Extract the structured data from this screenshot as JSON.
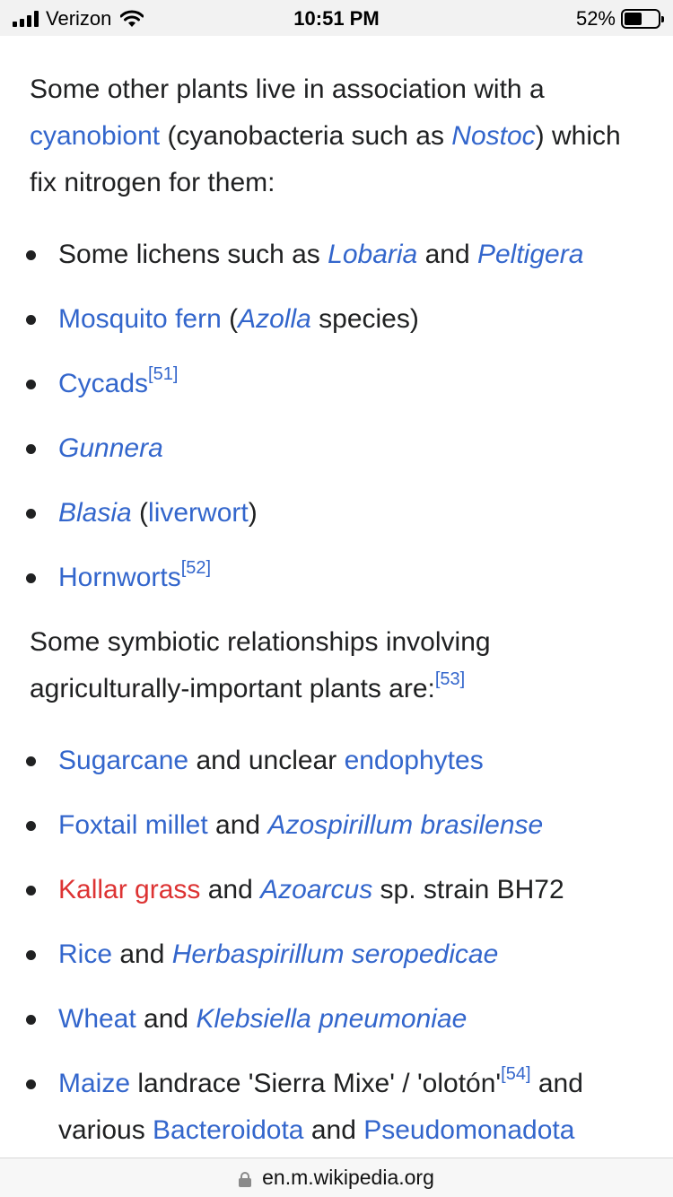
{
  "status": {
    "carrier": "Verizon",
    "time": "10:51 PM",
    "battery": "52%",
    "battery_level": 0.52
  },
  "para1": {
    "t1": "Some other plants live in association with a ",
    "link_cyanobiont": "cyanobiont",
    "t2": " (cyanobacteria such as ",
    "link_nostoc": "Nostoc",
    "t3": ") which fix nitrogen for them:"
  },
  "list1": {
    "lichens": {
      "t1": "Some lichens such as ",
      "lobaria": "Lobaria",
      "and": " and ",
      "peltigera": "Peltigera"
    },
    "mosquito": {
      "fern": "Mosquito fern",
      "open": " (",
      "azolla": "Azolla",
      "rest": " species)"
    },
    "cycads": {
      "link": "Cycads",
      "ref": "[51]"
    },
    "gunnera": {
      "link": "Gunnera"
    },
    "blasia": {
      "link": "Blasia",
      "open": " (",
      "liverwort": "liverwort",
      "close": ")"
    },
    "hornworts": {
      "link": "Hornworts",
      "ref": "[52]"
    }
  },
  "para2": {
    "text": "Some symbiotic relationships involving agriculturally-important plants are:",
    "ref": "[53]"
  },
  "list2": {
    "sugarcane": {
      "a": "Sugarcane",
      "t": " and unclear ",
      "b": "endophytes"
    },
    "foxtail": {
      "a": "Foxtail millet",
      "t": " and ",
      "b": "Azospirillum brasilense"
    },
    "kallar": {
      "a": "Kallar grass",
      "t": " and ",
      "b": "Azoarcus",
      "rest": " sp. strain BH72"
    },
    "rice": {
      "a": "Rice",
      "t": " and ",
      "b": "Herbaspirillum seropedicae"
    },
    "wheat": {
      "a": "Wheat",
      "t": " and ",
      "b": "Klebsiella pneumoniae"
    },
    "maize": {
      "a": "Maize",
      "t1": " landrace 'Sierra Mixe' / 'olotón'",
      "ref": "[54]",
      "t2": " and various ",
      "b": "Bacteroidota",
      "t3": " and ",
      "c": "Pseudomonadota"
    }
  },
  "url_bar": {
    "url": "en.m.wikipedia.org"
  }
}
